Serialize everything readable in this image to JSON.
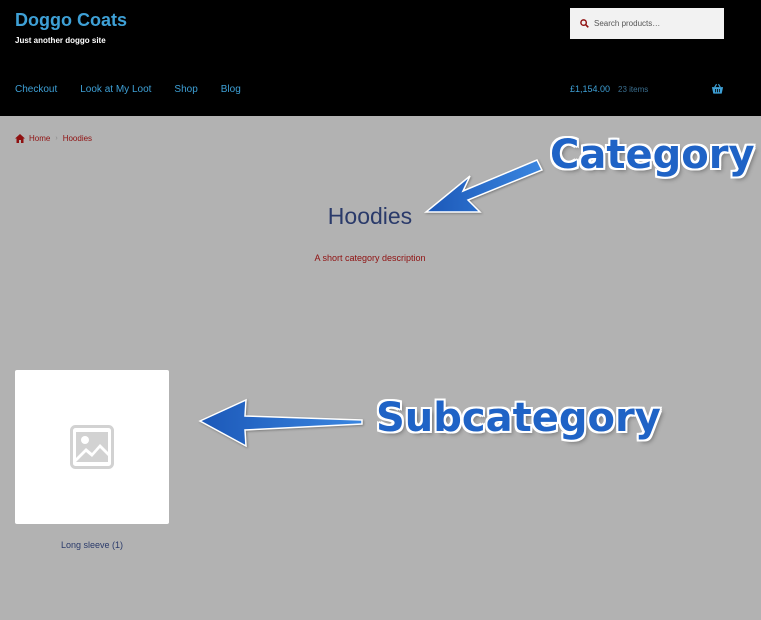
{
  "header": {
    "site_title": "Doggo Coats",
    "tagline": "Just another doggo site",
    "search_placeholder": "Search products…"
  },
  "nav": {
    "items": [
      {
        "label": "Checkout"
      },
      {
        "label": "Look at My Loot"
      },
      {
        "label": "Shop"
      },
      {
        "label": "Blog"
      }
    ]
  },
  "cart": {
    "total": "£1,154.00",
    "count": "23 items",
    "icon": "basket-icon"
  },
  "breadcrumb": {
    "home": "Home",
    "current": "Hoodies"
  },
  "category": {
    "title": "Hoodies",
    "description": "A short category description"
  },
  "subcategories": [
    {
      "label": "Long sleeve",
      "count": "(1)"
    }
  ],
  "annotations": {
    "category": "Category",
    "subcategory": "Subcategory"
  },
  "colors": {
    "accent": "#3ea0d6",
    "header_bg": "#000000",
    "page_bg": "#b2b2b2",
    "breadcrumb": "#8f1010",
    "annotation": "#1f63c6"
  }
}
